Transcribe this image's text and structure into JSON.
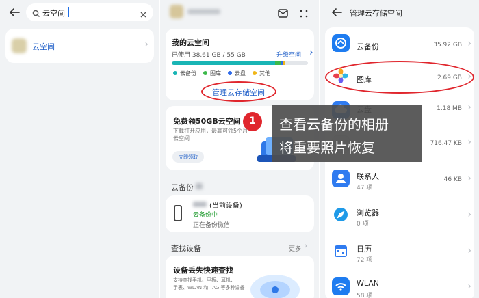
{
  "search_panel": {
    "search_value": "云空间",
    "result_label": "云空间"
  },
  "cloud_panel": {
    "my_cloud_title": "我的云空间",
    "used_label": "已使用 38.61 GB / 55 GB",
    "upgrade_label": "升级空间",
    "legend": [
      {
        "label": "云备份",
        "color": "#19b5b5"
      },
      {
        "label": "图库",
        "color": "#3cb94a"
      },
      {
        "label": "云盘",
        "color": "#2f6bea"
      },
      {
        "label": "其他",
        "color": "#f0b618"
      }
    ],
    "usage": {
      "total_gb": 55,
      "used_gb": 38.61
    },
    "manage_label": "管理云存储空间",
    "promo_title": "免费领50GB云空间",
    "promo_desc_1": "下载打开应用，最高可领5个月",
    "promo_desc_2": "云空间",
    "promo_button": "立即领取",
    "backup_section": "云备份",
    "device_name": "(当前设备)",
    "device_status": "云备份中",
    "device_status_sub": "正在备份微信…",
    "find_section": "查找设备",
    "find_more": "更多",
    "find_card_title": "设备丢失快速查找",
    "find_card_desc_1": "支持查找手机、平板、耳机、",
    "find_card_desc_2": "手表、WLAN 和 TAG 等多种设备"
  },
  "storage_panel": {
    "title": "管理云存储空间",
    "apps": [
      {
        "name": "云备份",
        "count": "",
        "size": "35.92 GB",
        "icon": "cloud-backup-icon",
        "color": "#1e7cf0"
      },
      {
        "name": "图库",
        "count": "",
        "size": "2.69 GB",
        "icon": "gallery-icon",
        "color": "#ffffff"
      },
      {
        "name": "云盘",
        "count": "",
        "size": "1.18 MB",
        "icon": "cloud-drive-icon",
        "color": "#2f7bf0"
      },
      {
        "name": "",
        "count": "",
        "size": "716.47 KB",
        "icon": "notes-icon",
        "color": "#f2f2f2"
      },
      {
        "name": "联系人",
        "count": "47 项",
        "size": "46 KB",
        "icon": "contacts-icon",
        "color": "#2f7bf0"
      },
      {
        "name": "浏览器",
        "count": "0 项",
        "size": "",
        "icon": "browser-icon",
        "color": "#ffffff"
      },
      {
        "name": "日历",
        "count": "72 项",
        "size": "",
        "icon": "calendar-icon",
        "color": "#ffffff"
      },
      {
        "name": "WLAN",
        "count": "58 项",
        "size": "",
        "icon": "wlan-icon",
        "color": "#1e7cf0"
      }
    ]
  },
  "callout": {
    "step": "1",
    "line1": "查看云备份的相册",
    "line2": "将重要照片恢复"
  }
}
